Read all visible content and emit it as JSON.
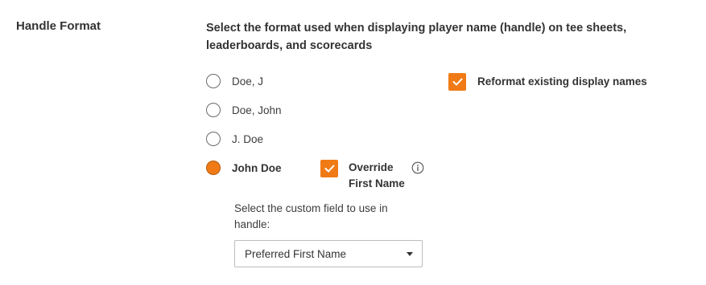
{
  "section": {
    "label": "Handle Format",
    "description": "Select the format used when displaying player name (handle) on tee sheets, leaderboards, and scorecards"
  },
  "handle_options": [
    {
      "label": "Doe, J",
      "selected": false
    },
    {
      "label": "Doe, John",
      "selected": false
    },
    {
      "label": "J. Doe",
      "selected": false
    },
    {
      "label": "John Doe",
      "selected": true
    }
  ],
  "override_first_name": {
    "label_line1": "Override",
    "label_line2": "First Name",
    "checked": true,
    "icon": "info-icon"
  },
  "reformat_existing": {
    "label": "Reformat existing display names",
    "checked": true
  },
  "custom_field": {
    "label": "Select the custom field to use in handle:",
    "selected_value": "Preferred First Name"
  },
  "colors": {
    "accent": "#f07b16",
    "text": "#333333"
  }
}
